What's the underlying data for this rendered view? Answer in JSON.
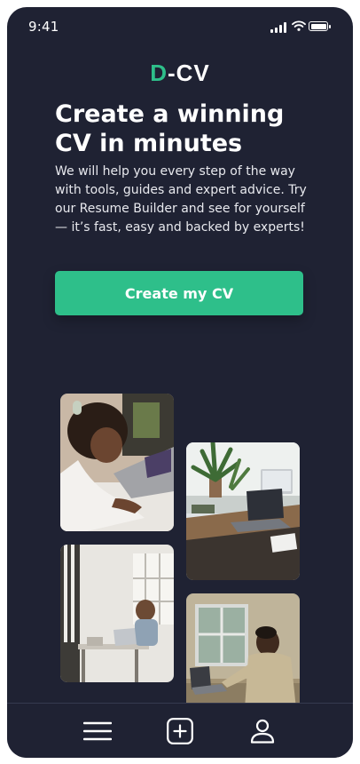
{
  "status_bar": {
    "time": "9:41"
  },
  "brand": {
    "logo_first": "D",
    "logo_rest": "-CV",
    "accent": "#2ebf8a",
    "background": "#1f2233"
  },
  "hero": {
    "title": "Create a winning CV in minutes",
    "description": "We will help you every step of the way with tools, guides and expert advice. Try our Resume Builder and see for yourself — it’s fast, easy and backed by experts!",
    "cta_label": "Create my CV"
  },
  "gallery": {
    "photos": [
      {
        "subject": "woman-writing-notes-photo"
      },
      {
        "subject": "desk-with-laptop-and-plants-photo"
      },
      {
        "subject": "woman-working-at-cafe-photo"
      },
      {
        "subject": "man-working-on-laptop-photo"
      }
    ]
  },
  "bottom_nav": {
    "icons": [
      "menu-icon",
      "add-icon",
      "profile-icon"
    ]
  }
}
